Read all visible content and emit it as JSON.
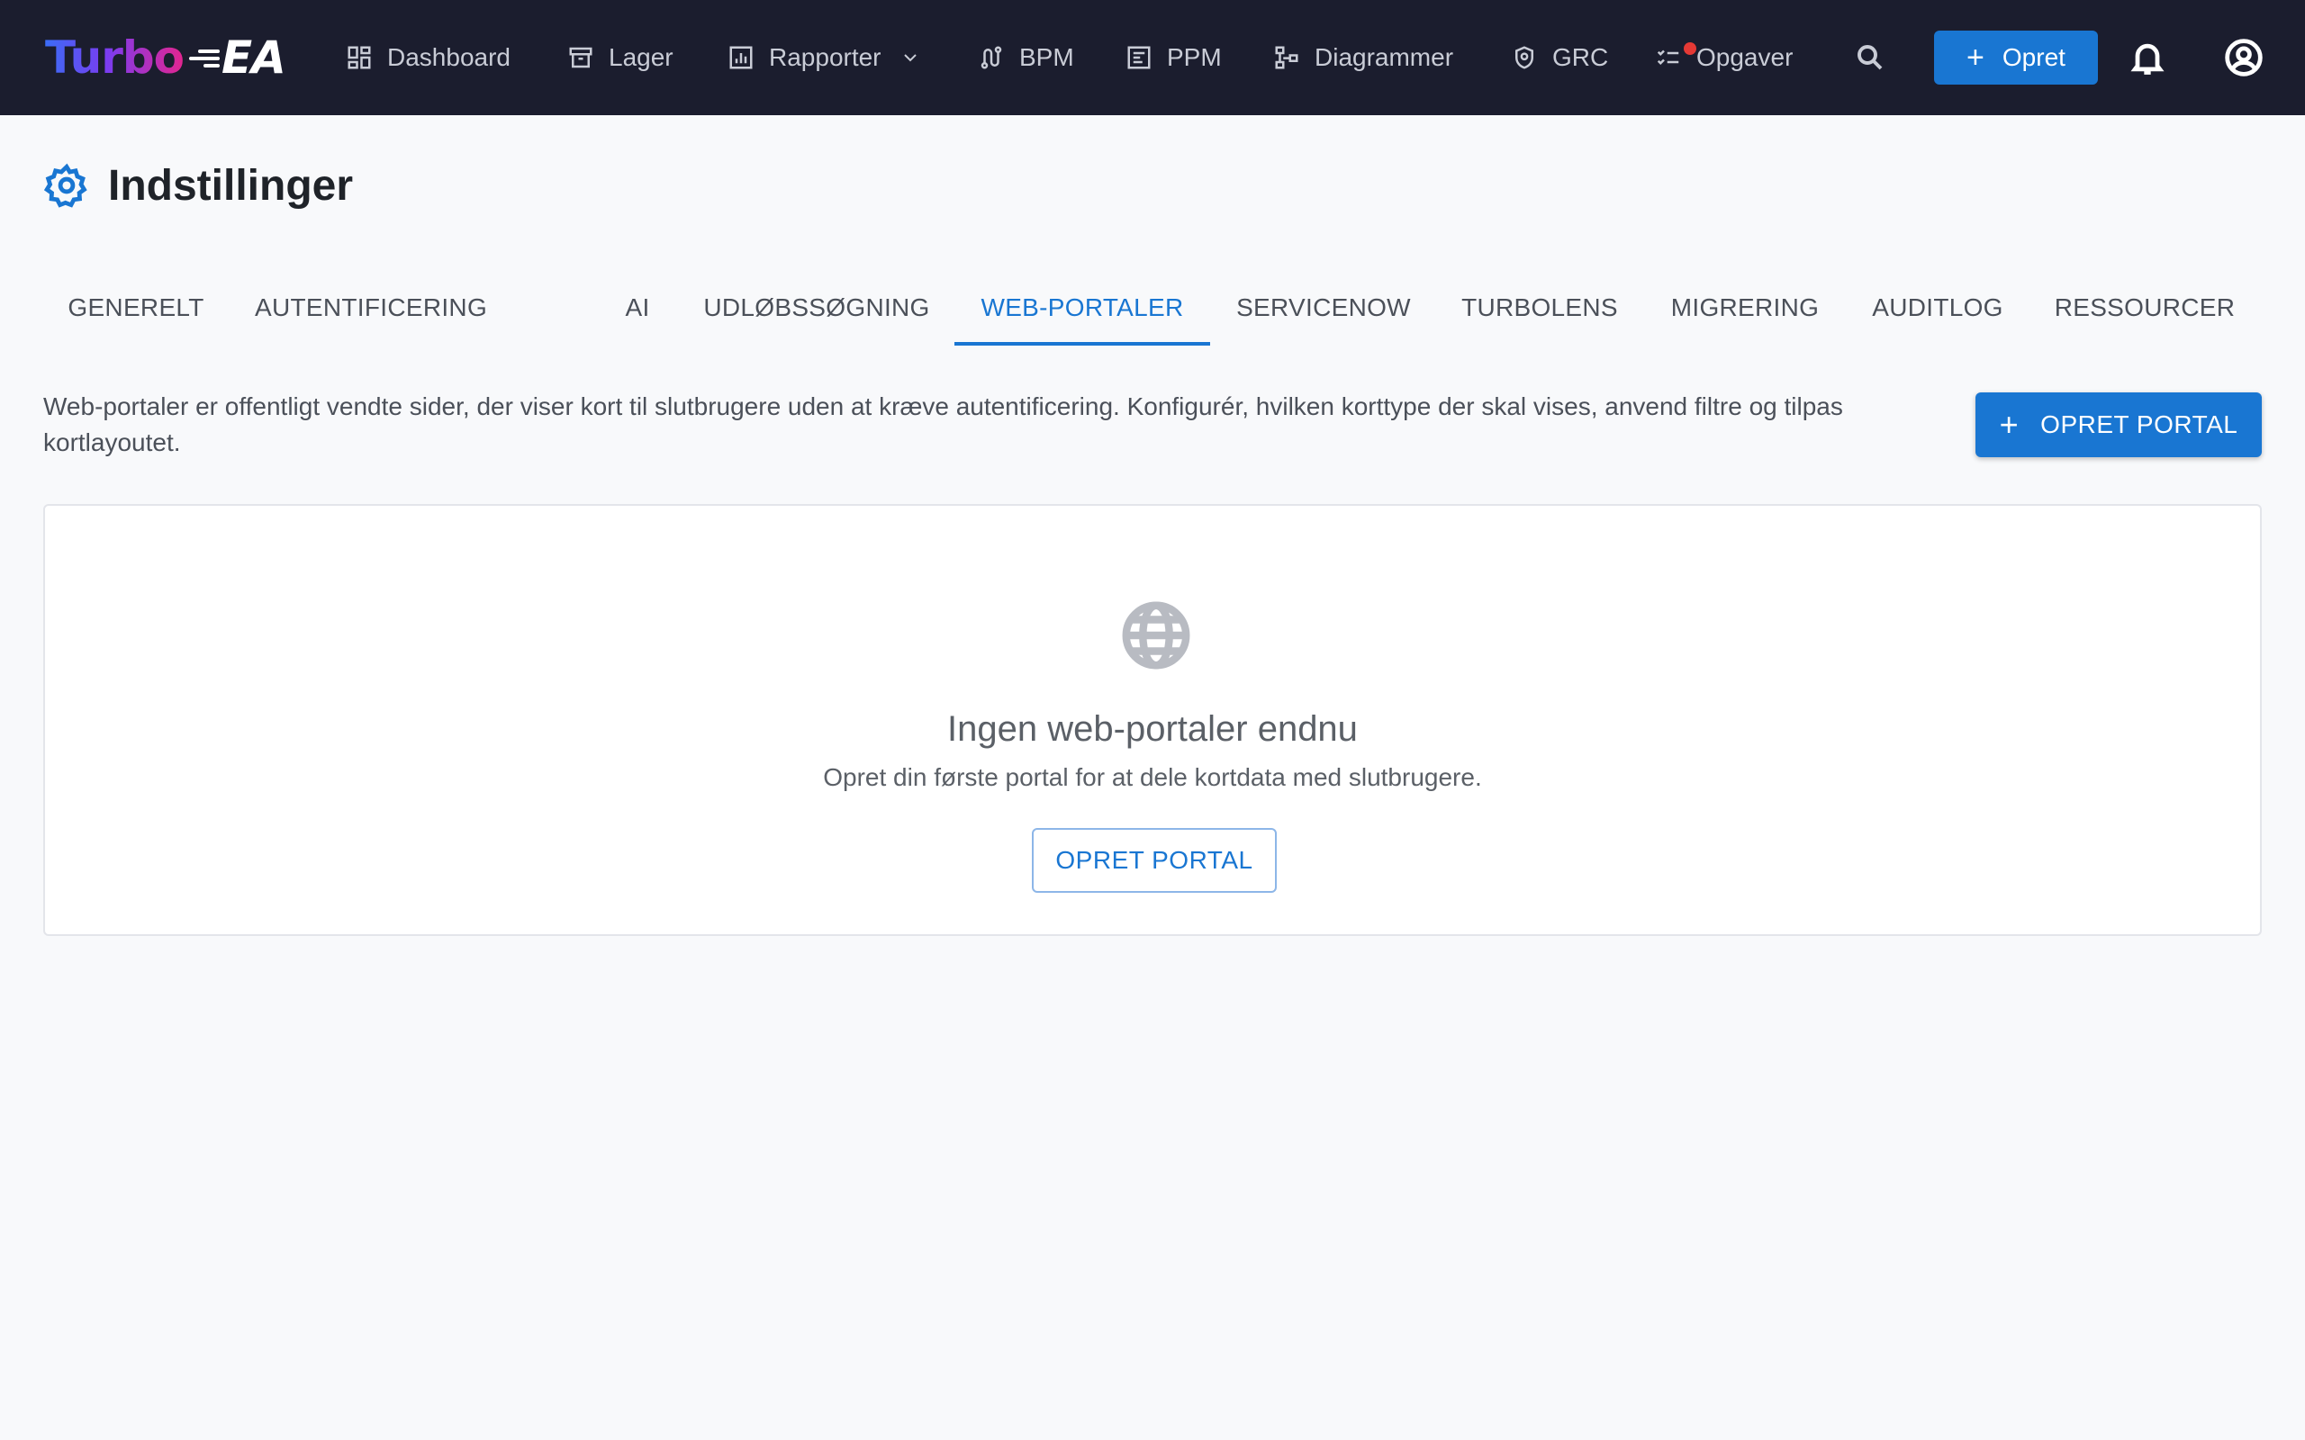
{
  "app": {
    "logo_primary": "Turbo",
    "logo_secondary": "EA"
  },
  "nav": {
    "items": [
      {
        "label": "Dashboard",
        "icon": "dashboard-icon"
      },
      {
        "label": "Lager",
        "icon": "archive-icon"
      },
      {
        "label": "Rapporter",
        "icon": "report-icon",
        "has_dropdown": true
      },
      {
        "label": "BPM",
        "icon": "route-icon"
      },
      {
        "label": "PPM",
        "icon": "project-icon"
      },
      {
        "label": "Diagrammer",
        "icon": "diagram-icon"
      },
      {
        "label": "GRC",
        "icon": "shield-icon"
      },
      {
        "label": "Opgaver",
        "icon": "checklist-icon",
        "has_notification_dot": true
      }
    ],
    "create_label": "Opret"
  },
  "page": {
    "title": "Indstillinger",
    "title_icon": "gear-icon"
  },
  "tabs": [
    {
      "label": "GENERELT",
      "active": false
    },
    {
      "label": "AUTENTIFICERING",
      "active": false
    },
    {
      "label": "AI",
      "active": false
    },
    {
      "label": "UDLØBSSØGNING",
      "active": false
    },
    {
      "label": "WEB-PORTALER",
      "active": true
    },
    {
      "label": "SERVICENOW",
      "active": false
    },
    {
      "label": "TURBOLENS",
      "active": false
    },
    {
      "label": "MIGRERING",
      "active": false
    },
    {
      "label": "AUDITLOG",
      "active": false
    },
    {
      "label": "RESSOURCER",
      "active": false
    }
  ],
  "web_portals": {
    "description": "Web-portaler er offentligt vendte sider, der viser kort til slutbrugere uden at kræve autentificering. Konfigurér, hvilken korttype der skal vises, anvend filtre og tilpas kortlayoutet.",
    "create_button_label": "OPRET PORTAL",
    "empty_state": {
      "icon": "globe-icon",
      "title": "Ingen web-portaler endnu",
      "subtitle": "Opret din første portal for at dele kortdata med slutbrugere.",
      "button_label": "OPRET PORTAL"
    }
  },
  "colors": {
    "topbar_bg": "#1b1d2e",
    "accent": "#1976d2",
    "notification": "#e53935",
    "page_bg": "#f8f9fb"
  }
}
